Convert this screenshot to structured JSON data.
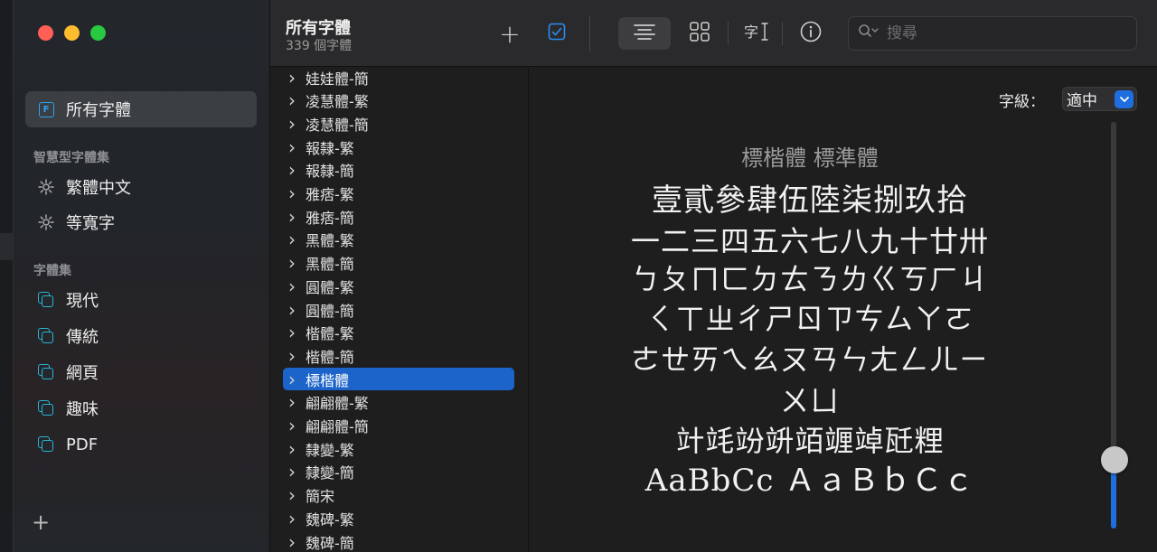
{
  "window": {
    "title": "所有字體",
    "subtitle": "339 個字體"
  },
  "sidebar": {
    "all_fonts_label": "所有字體",
    "smart_header": "智慧型字體集",
    "smart_items": [
      {
        "label": "繁體中文",
        "icon": "gear-icon"
      },
      {
        "label": "等寬字",
        "icon": "gear-icon"
      }
    ],
    "collections_header": "字體集",
    "collections": [
      {
        "label": "現代",
        "icon": "collection-icon"
      },
      {
        "label": "傳統",
        "icon": "collection-icon"
      },
      {
        "label": "網頁",
        "icon": "collection-icon"
      },
      {
        "label": "趣味",
        "icon": "collection-icon"
      },
      {
        "label": "PDF",
        "icon": "collection-icon"
      }
    ],
    "add_label": "+"
  },
  "toolbar": {
    "add_label": "+",
    "search_placeholder": "搜尋"
  },
  "font_list": {
    "items": [
      "娃娃體-簡",
      "凌慧體-繁",
      "凌慧體-簡",
      "報隸-繁",
      "報隸-簡",
      "雅痞-繁",
      "雅痞-簡",
      "黑體-繁",
      "黑體-簡",
      "圓體-繁",
      "圓體-簡",
      "楷體-繁",
      "楷體-簡",
      "標楷體",
      "翩翩體-繁",
      "翩翩體-簡",
      "隸變-繁",
      "隸變-簡",
      "簡宋",
      "魏碑-繁",
      "魏碑-簡"
    ],
    "selected_index": 13
  },
  "preview": {
    "size_label": "字級：",
    "size_value": "適中",
    "font_name": "標楷體 標準體",
    "lines": [
      "壹貳參肆伍陸柒捌玖拾",
      "一二三四五六七八九十廿卅",
      "ㄅㄆㄇㄈㄉㄊㄋㄌㄍㄎㄏㄐ",
      "ㄑㄒㄓㄔㄕㄖㄗㄘㄙㄚㄛ",
      "ㄜㄝㄞㄟㄠㄡㄢㄣㄤㄥㄦㄧ",
      "ㄨㄩ",
      "竍竓竕竔竡竰竨瓩粴",
      "AaBbCc ＡａＢｂＣｃ"
    ],
    "slider_fraction": 0.17
  },
  "colors": {
    "accent": "#1c64c9",
    "close": "#ff5f57",
    "minimize": "#febc2e",
    "maximize": "#28c840"
  }
}
